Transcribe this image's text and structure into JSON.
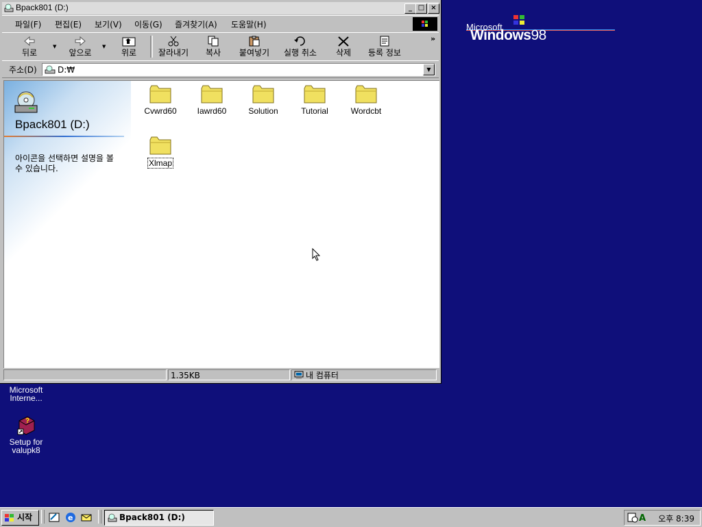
{
  "desktop": {
    "logo": {
      "microsoft": "Microsoft",
      "windows": "Windows",
      "version": "98"
    },
    "icons": [
      {
        "label_line1": "Microsoft",
        "label_line2": "Interne..."
      },
      {
        "label_line1": "Setup for",
        "label_line2": "valupk8"
      }
    ],
    "background_color": "#0f0f7a"
  },
  "window": {
    "title": "Bpack801 (D:)",
    "buttons": {
      "minimize": "_",
      "maximize": "□",
      "close": "×"
    },
    "menu": [
      "파일(F)",
      "편집(E)",
      "보기(V)",
      "이동(G)",
      "즐겨찾기(A)",
      "도움말(H)"
    ],
    "toolbar": {
      "back": "뒤로",
      "forward": "앞으로",
      "up": "위로",
      "cut": "잘라내기",
      "copy": "복사",
      "paste": "붙여넣기",
      "undo": "실행 취소",
      "delete": "삭제",
      "properties": "등록 정보",
      "more": "»"
    },
    "address": {
      "label": "주소(D)",
      "value": "D:₩"
    },
    "webview": {
      "title": "Bpack801 (D:)",
      "description": "아이콘을 선택하면 설명을 볼 수 있습니다."
    },
    "folders": [
      "Cvwrd60",
      "Iawrd60",
      "Solution",
      "Tutorial",
      "Wordcbt",
      "Xlmap"
    ],
    "status": {
      "size": "1.35KB",
      "zone": "내 컴퓨터"
    }
  },
  "taskbar": {
    "start": "시작",
    "active_task": "Bpack801 (D:)",
    "clock": "오후 8:39"
  }
}
